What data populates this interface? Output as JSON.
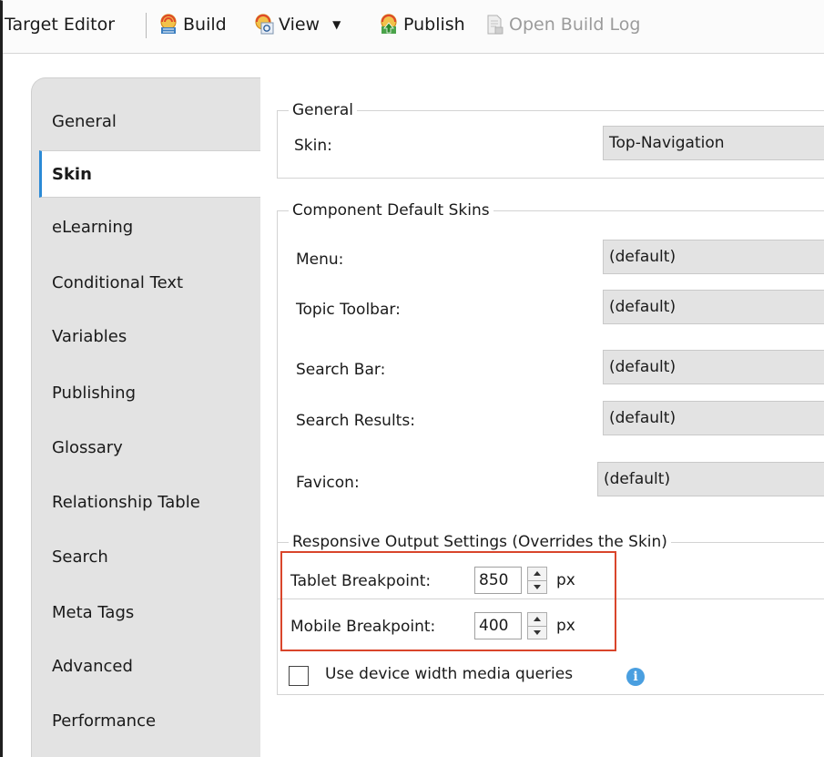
{
  "toolbar": {
    "title": "Target Editor",
    "buttons": [
      {
        "label": "Build",
        "icon": "build-icon"
      },
      {
        "label": "View",
        "icon": "view-icon"
      },
      {
        "label": "Publish",
        "icon": "publish-icon"
      },
      {
        "label": "Open Build Log",
        "icon": "build-log-icon"
      }
    ],
    "view_caret": "▼"
  },
  "nav": {
    "items": [
      {
        "label": "General"
      },
      {
        "label": "Skin",
        "active": true
      },
      {
        "label": "eLearning"
      },
      {
        "label": "Conditional Text"
      },
      {
        "label": "Variables"
      },
      {
        "label": "Publishing"
      },
      {
        "label": "Glossary"
      },
      {
        "label": "Relationship Table"
      },
      {
        "label": "Search"
      },
      {
        "label": "Meta Tags"
      },
      {
        "label": "Advanced"
      },
      {
        "label": "Performance"
      }
    ]
  },
  "general": {
    "legend": "General",
    "skin_label": "Skin:",
    "skin_value": "Top-Navigation"
  },
  "component": {
    "legend": "Component Default Skins",
    "rows": [
      {
        "label": "Menu:",
        "value": "(default)"
      },
      {
        "label": "Topic Toolbar:",
        "value": "(default)"
      },
      {
        "label": "Search Bar:",
        "value": "(default)"
      },
      {
        "label": "Search Results:",
        "value": "(default)"
      },
      {
        "label": "Favicon:",
        "value": "(default)"
      }
    ]
  },
  "responsive": {
    "legend": "Responsive Output Settings (Overrides the Skin)",
    "tablet_label": "Tablet Breakpoint:",
    "tablet_value": "850",
    "mobile_label": "Mobile Breakpoint:",
    "mobile_value": "400",
    "unit": "px",
    "checkbox_label": "Use device width media queries",
    "info_glyph": "i"
  },
  "colors": {
    "accent": "#2b8ad6",
    "highlight": "#d9452b"
  }
}
